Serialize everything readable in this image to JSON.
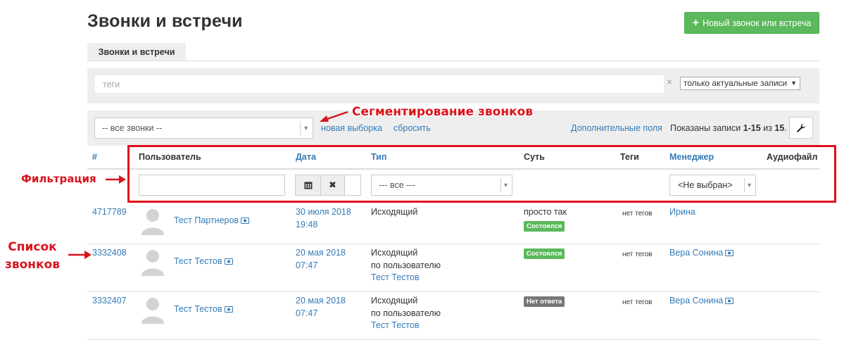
{
  "page": {
    "title": "Звонки и встречи",
    "new_button_label": "Новый звонок или встреча",
    "tab_label": "Звонки и встречи"
  },
  "tags_filter": {
    "placeholder": "теги",
    "clear_symbol": "×",
    "scope_select": "только актуальные записи"
  },
  "segment": {
    "select_value": "-- все звонки --",
    "new_selection_link": "новая выборка",
    "reset_link": "сбросить",
    "extra_fields_link": "Дополнительные поля",
    "shown_prefix": "Показаны записи ",
    "shown_range": "1-15",
    "shown_middle": " из ",
    "shown_total": "15",
    "shown_suffix": "."
  },
  "annotations": {
    "segmentation": "Сегментирование звонков",
    "filtering": "Фильтрация",
    "list_line1": "Список",
    "list_line2": "звонков"
  },
  "table": {
    "columns": {
      "id": "#",
      "user": "Пользователь",
      "date": "Дата",
      "type": "Тип",
      "essence": "Суть",
      "tags": "Теги",
      "manager": "Менеджер",
      "audio": "Аудиофайл"
    },
    "filters": {
      "type_select": "--- все ---",
      "manager_select": "<Не выбран>"
    },
    "rows": [
      {
        "id": "4717789",
        "user": "Тест Партнеров",
        "date": "30 июля 2018",
        "time": "19:48",
        "type_line1": "Исходящий",
        "type_line2": "",
        "type_line3": "",
        "essence": "просто так",
        "status": "Состоялся",
        "tags": "нет тегов",
        "manager": "Ирина"
      },
      {
        "id": "3332408",
        "user": "Тест Тестов",
        "date": "20 мая 2018",
        "time": "07:47",
        "type_line1": "Исходящий",
        "type_line2": "по пользователю",
        "type_line3": "Тест Тестов",
        "essence": "",
        "status": "Состоялся",
        "tags": "нет тегов",
        "manager": "Вера Сонина"
      },
      {
        "id": "3332407",
        "user": "Тест Тестов",
        "date": "20 мая 2018",
        "time": "07:47",
        "type_line1": "Исходящий",
        "type_line2": "по пользователю",
        "type_line3": "Тест Тестов",
        "essence": "",
        "status": "Нет ответа",
        "tags": "нет тегов",
        "manager": "Вера Сонина"
      }
    ]
  },
  "colors": {
    "accent_link": "#337ab7",
    "success": "#5cb85c",
    "annotation_red": "#d9131d",
    "panel_grey": "#eeeeee"
  }
}
